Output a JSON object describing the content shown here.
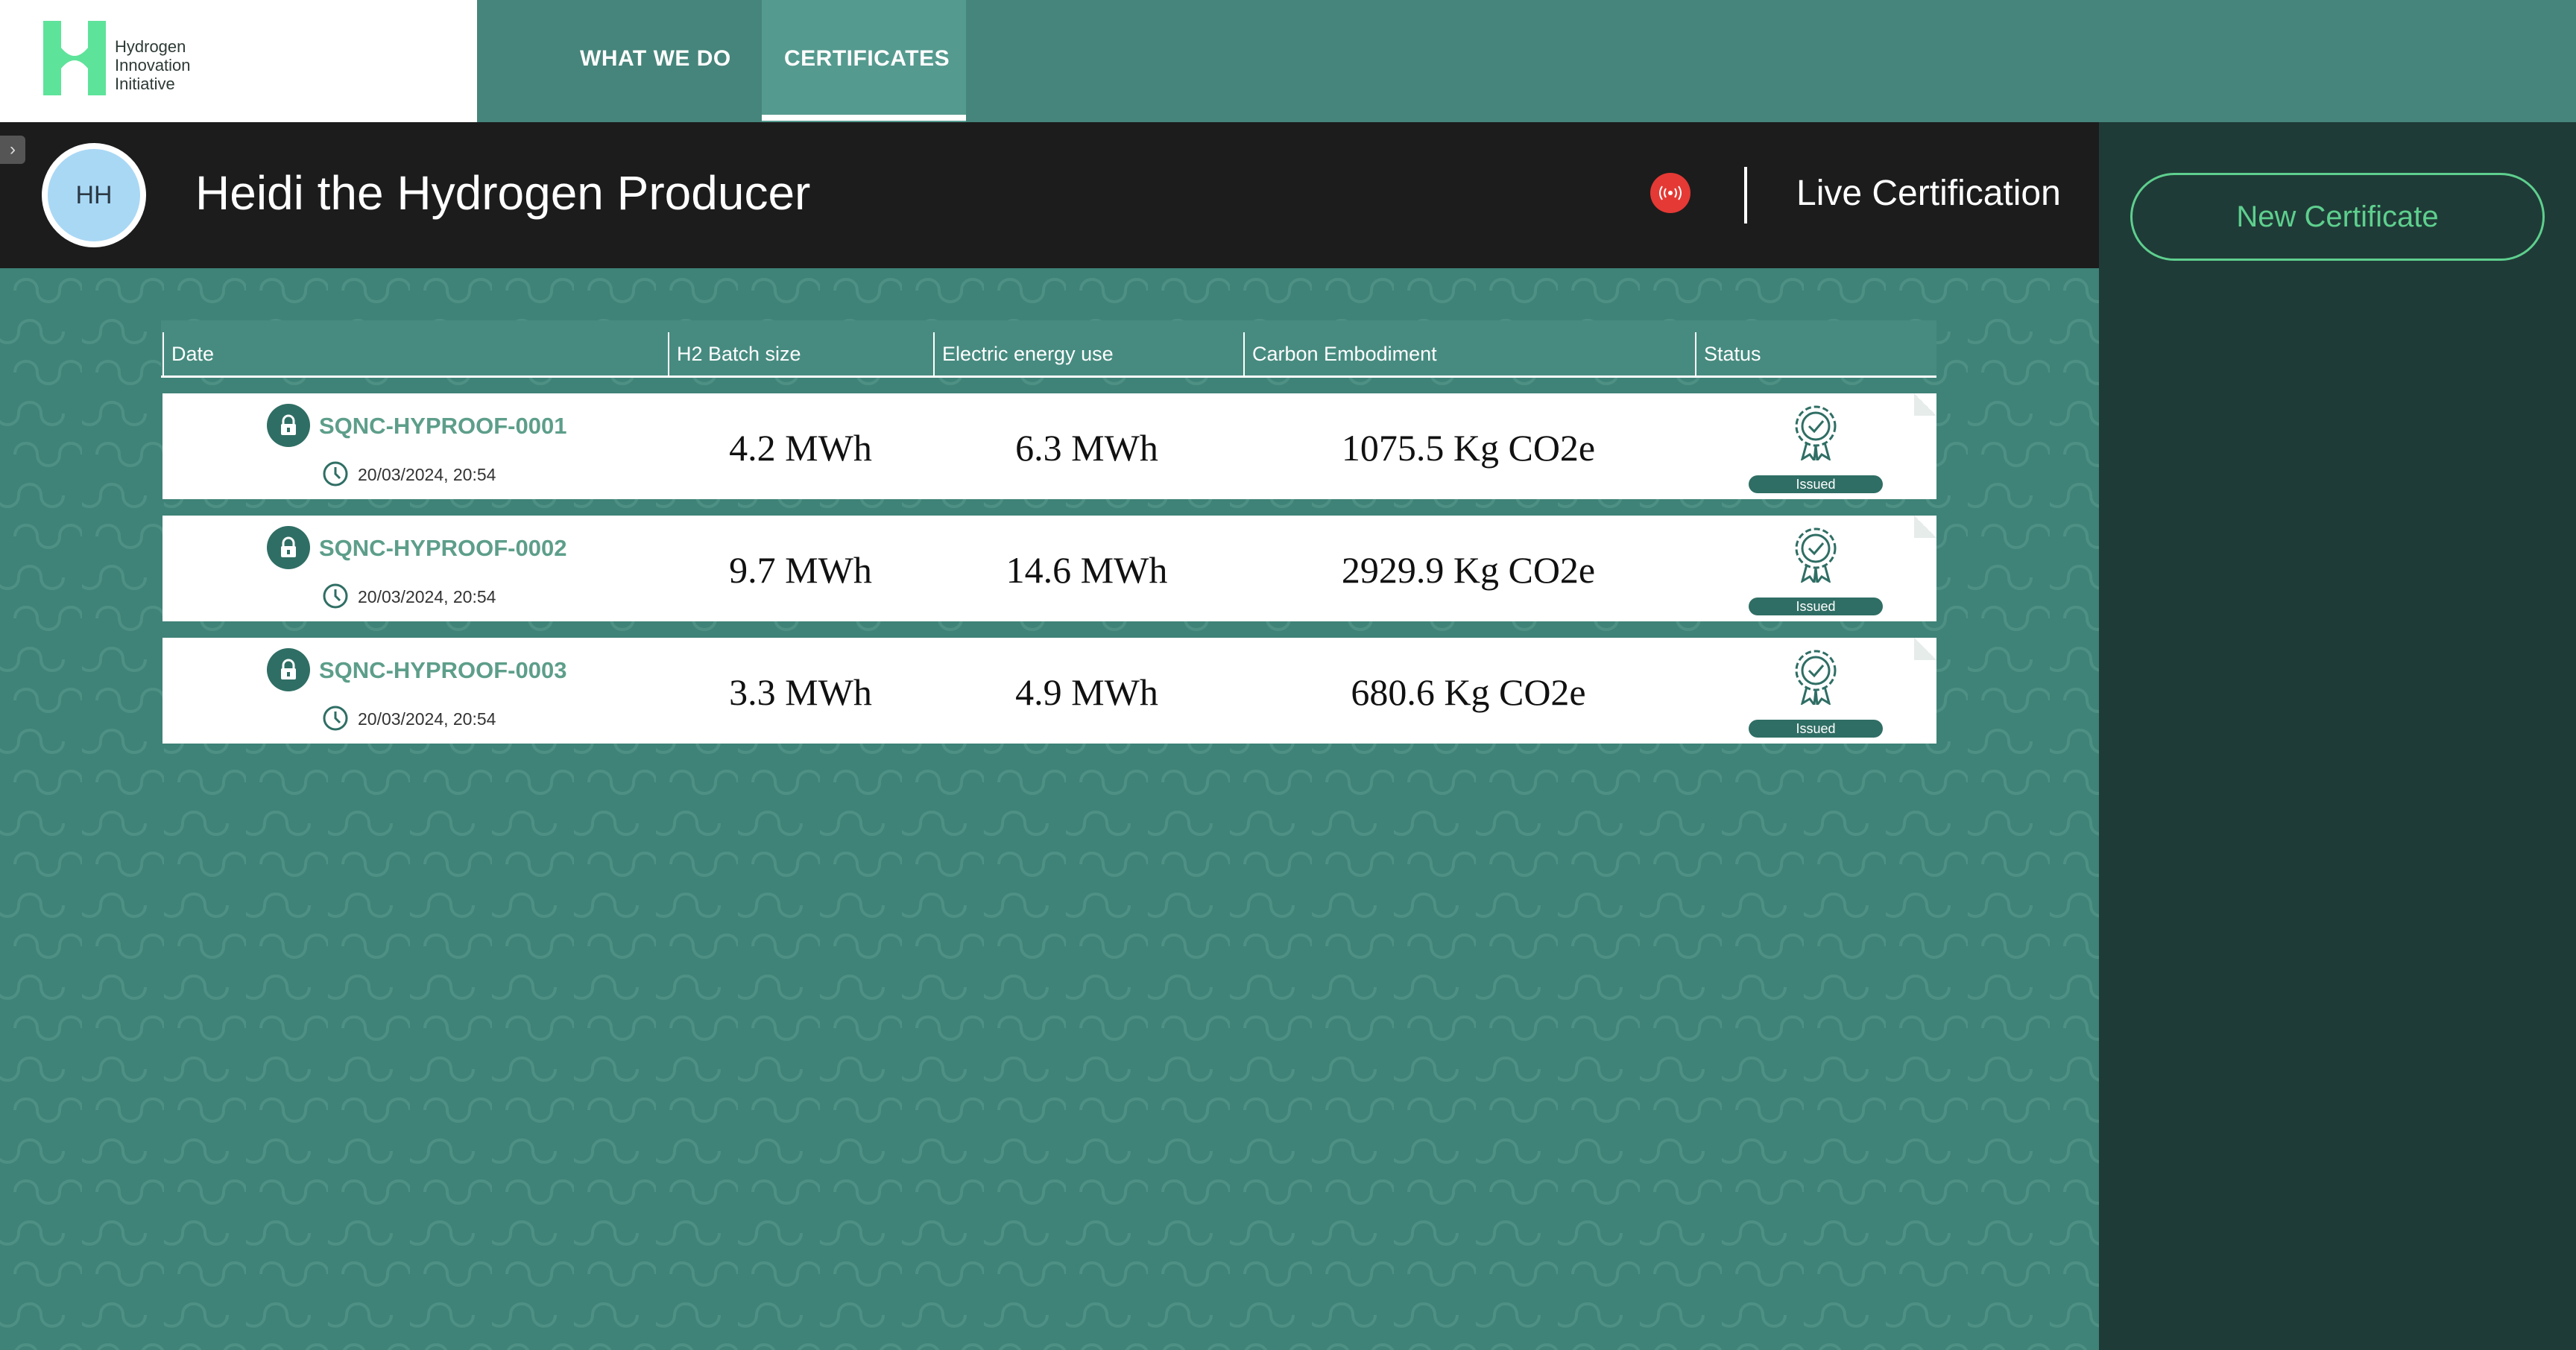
{
  "brand": {
    "logo_lines": [
      "Hydrogen",
      "Innovation",
      "Initiative"
    ],
    "logo_color": "#5ee39a"
  },
  "nav": {
    "items": [
      {
        "label": "WHAT WE DO"
      },
      {
        "label": "CERTIFICATES",
        "active": true
      }
    ]
  },
  "header": {
    "avatar_initials": "HH",
    "title": "Heidi the Hydrogen Producer",
    "live_icon": "broadcast-icon",
    "live_label": "Live Certification"
  },
  "sidebar": {
    "new_certificate_label": "New Certificate",
    "accent_color": "#5ecf8e"
  },
  "table": {
    "columns": [
      "Date",
      "H2 Batch size",
      "Electric energy use",
      "Carbon Embodiment",
      "Status"
    ],
    "rows": [
      {
        "id": "SQNC-HYPROOF-0001",
        "datetime": "20/03/2024, 20:54",
        "h2_batch": "4.2 MWh",
        "energy": "6.3 MWh",
        "carbon": "1075.5 Kg CO2e",
        "status": "Issued"
      },
      {
        "id": "SQNC-HYPROOF-0002",
        "datetime": "20/03/2024, 20:54",
        "h2_batch": "9.7 MWh",
        "energy": "14.6 MWh",
        "carbon": "2929.9 Kg CO2e",
        "status": "Issued"
      },
      {
        "id": "SQNC-HYPROOF-0003",
        "datetime": "20/03/2024, 20:54",
        "h2_batch": "3.3 MWh",
        "energy": "4.9 MWh",
        "carbon": "680.6 Kg CO2e",
        "status": "Issued"
      }
    ]
  },
  "colors": {
    "nav_bg": "#46857b",
    "header_bg": "#1c1c1c",
    "main_bg": "#3f8277",
    "right_panel_bg": "#1f3b37",
    "badge_bg": "#2f6e64",
    "live_red": "#e53935"
  }
}
